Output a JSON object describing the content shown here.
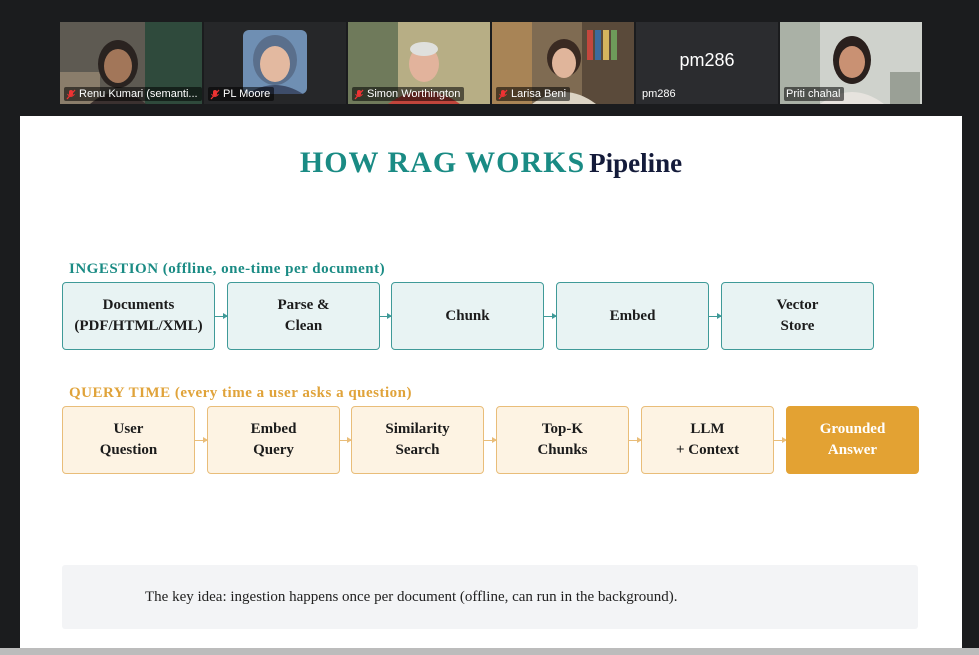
{
  "meeting": {
    "participants": [
      {
        "name": "Renu Kumari (semanti...",
        "muted": true
      },
      {
        "name": "PL Moore",
        "muted": true
      },
      {
        "name": "Simon Worthington",
        "muted": true
      },
      {
        "name": "Larisa Beni",
        "muted": true
      },
      {
        "name": "pm286",
        "muted": false,
        "center_label": "pm286"
      },
      {
        "name": "Priti chahal",
        "muted": false,
        "active_speaker": true
      }
    ]
  },
  "slide": {
    "title_main": "HOW RAG WORKS",
    "title_sub": "Pipeline",
    "ingestion": {
      "label": "INGESTION (offline, one-time per document)",
      "steps": [
        "Documents\n(PDF/HTML/XML)",
        "Parse &\nClean",
        "Chunk",
        "Embed",
        "Vector\nStore"
      ]
    },
    "query": {
      "label": "QUERY TIME (every time a user asks a question)",
      "steps": [
        "User\nQuestion",
        "Embed\nQuery",
        "Similarity\nSearch",
        "Top-K\nChunks",
        "LLM\n+ Context",
        "Grounded\nAnswer"
      ]
    },
    "key_idea": "The key idea: ingestion happens once per document (offline, can run in the background)."
  },
  "colors": {
    "teal": "#1a8b84",
    "amber": "#e3a233",
    "active_speaker": "#2ecc40"
  }
}
